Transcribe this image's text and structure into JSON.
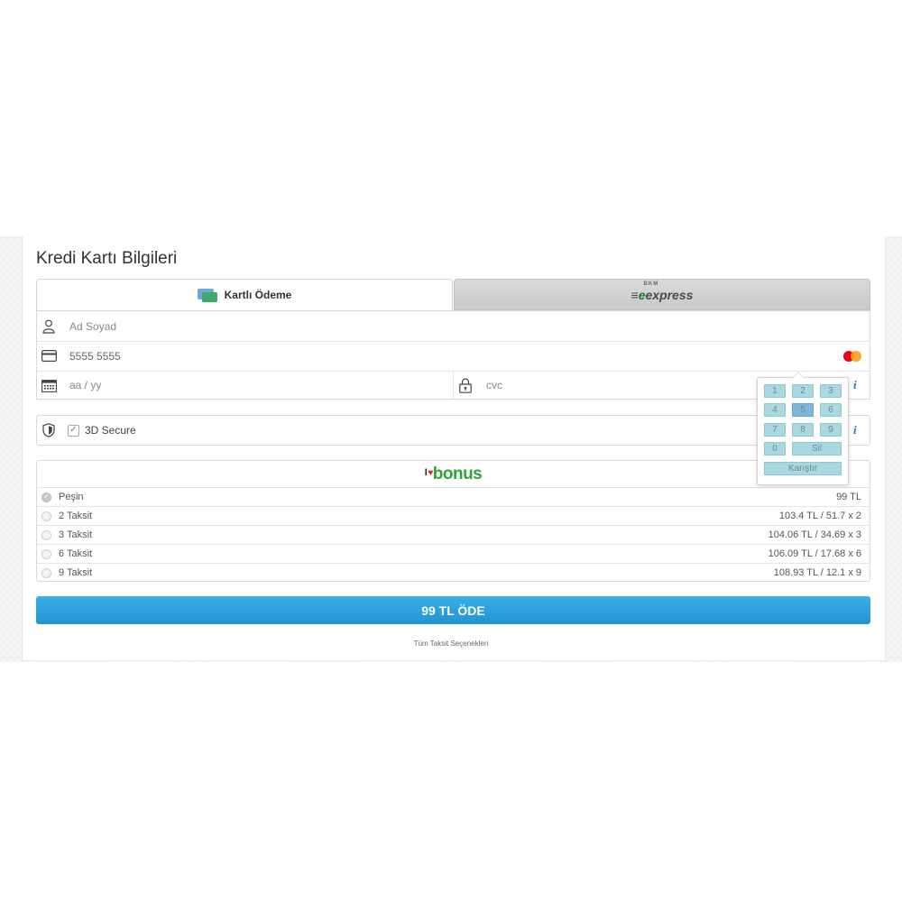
{
  "title": "Kredi Kartı Bilgileri",
  "tabs": {
    "card_label": "Kartlı Ödeme",
    "express_label": "express",
    "express_prefix": "e",
    "express_small": "BKM"
  },
  "form": {
    "name_placeholder": "Ad Soyad",
    "card_number_value": "5555 5555",
    "expiry_placeholder": "aa / yy",
    "cvc_placeholder": "cvc",
    "card_brand": "mastercard"
  },
  "secure": {
    "label": "3D Secure",
    "checked": true
  },
  "info_glyph": "i",
  "bonus": {
    "logo_text": "bonus",
    "logo_prefix": "I",
    "heart": "♥"
  },
  "installments": [
    {
      "label": "Peşin",
      "price": "99 TL",
      "selected": true
    },
    {
      "label": "2 Taksit",
      "price": "103.4 TL / 51.7 x 2",
      "selected": false
    },
    {
      "label": "3 Taksit",
      "price": "104.06 TL / 34.69 x 3",
      "selected": false
    },
    {
      "label": "6 Taksit",
      "price": "106.09 TL / 17.68 x 6",
      "selected": false
    },
    {
      "label": "9 Taksit",
      "price": "108.93 TL / 12.1 x 9",
      "selected": false
    }
  ],
  "keypad": {
    "keys": [
      "1",
      "2",
      "3",
      "4",
      "5",
      "6",
      "7",
      "8",
      "9",
      "0"
    ],
    "active_key": "5",
    "delete_label": "Sil",
    "shuffle_label": "Karıştır"
  },
  "pay_button": "99 TL ÖDE",
  "all_installments_link": "Tüm Taksit Seçenekleri",
  "colors": {
    "accent": "#2394d3",
    "bonus_green": "#2fa33a",
    "keypad_key": "#a9d8e0",
    "info_blue": "#2c6cd1"
  }
}
